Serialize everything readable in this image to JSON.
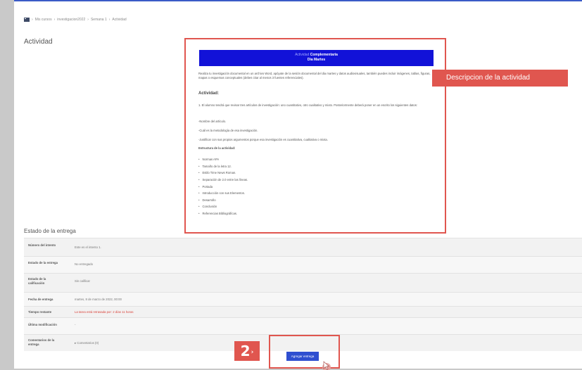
{
  "breadcrumb": {
    "items": [
      "Mis cursos",
      "investigacion2022",
      "Semana 1",
      "Actividad"
    ],
    "separator": "›"
  },
  "page": {
    "heading": "Actividad"
  },
  "activity": {
    "banner_prefix": "Actividad",
    "banner_title": "Complementaria",
    "banner_subtitle": "Dia Martes",
    "intro": "Realiza tu investigación documental en un archivo Word, apóyate de la sesión documental del dia martes y datos audiovisuales, también puedes incluir imágenes, tablas, figuras, mapas o esquemas conceptuales (debes citar al menos 3 fuentes referenciales).",
    "section_title": "Actividad:",
    "instruction": "1. El alumno tendrá que revisar tres artículos de investigación: uno cuantitativo, otro cualitativo y mixto. Posteriormente deberá poner en un escrito los siguientes datos:",
    "data_points": [
      "-Nombre del artículo.",
      "-Cuál es la metodología de esa investigación.",
      "-Justificar con sus propios argumentos porque esa investigación es cuantitativa, cualitativa o mixta."
    ],
    "structure_title": "Estructura de la actividad:",
    "structure_items": [
      "Normas APA",
      "Tamaño de la letra 12.",
      "Estilo Time News Roman.",
      "Separación de 2.0 entre las líneas.",
      "Portada",
      "Introducción con sus Elementos.",
      "Desarrollo",
      "Conclusión",
      "Referencias Bibliográficas."
    ]
  },
  "callout": {
    "label": "Descripcion de la actividad"
  },
  "status": {
    "title": "Estado de la entrega",
    "rows": [
      {
        "label": "Número del intento",
        "value": "Este es el intento 1."
      },
      {
        "label": "Estado de la entrega",
        "value": "No entregado"
      },
      {
        "label": "Estado de la calificación",
        "value": "Sin calificar"
      },
      {
        "label": "Fecha de entrega",
        "value": "martes, 8 de marzo de 2022, 00:00"
      },
      {
        "label": "Tiempo restante",
        "value": "La tarea está retrasada por: 2 días 11 horas"
      },
      {
        "label": "Última modificación",
        "value": "-"
      },
      {
        "label": "Comentarios de la entrega",
        "value": "Comentarios (0)"
      }
    ]
  },
  "step": {
    "number": "2",
    "arrow": "›"
  },
  "submit": {
    "label": "Agregar entrega"
  },
  "colors": {
    "accent": "#e0564f",
    "banner": "#1212d8",
    "button": "#2f4fd0",
    "overdue": "#d9423a"
  }
}
